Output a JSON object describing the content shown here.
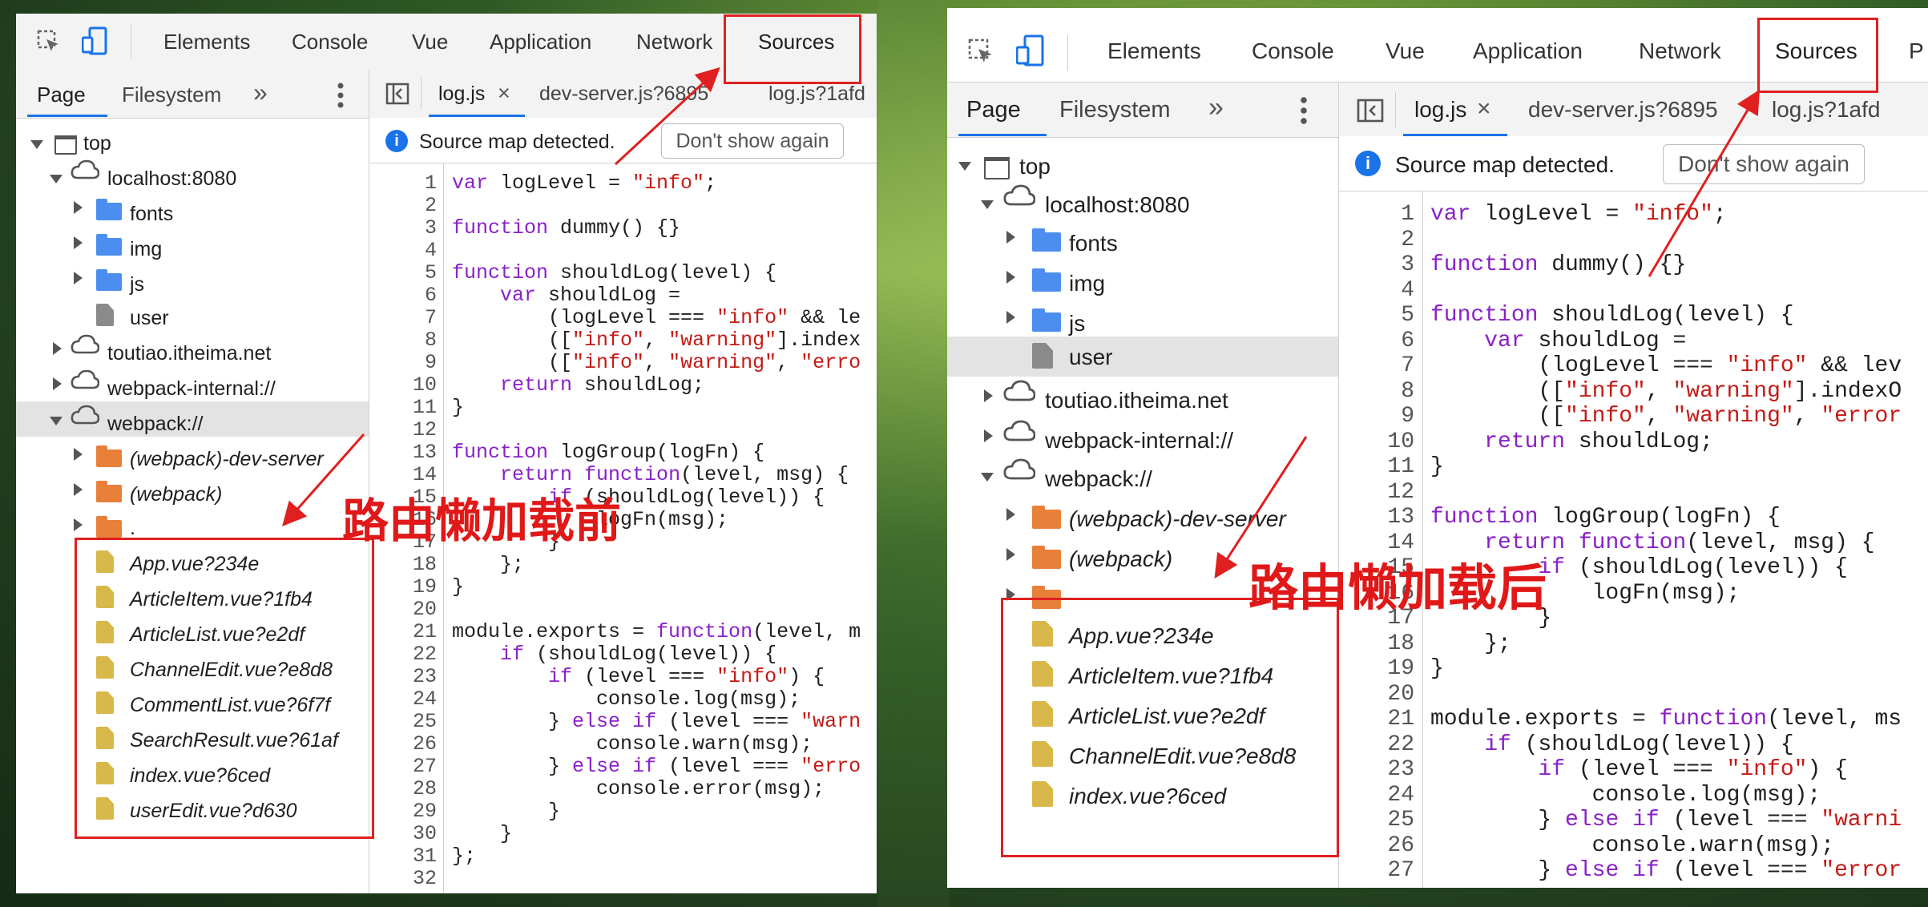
{
  "toolbar": {
    "tabs": [
      "Elements",
      "Console",
      "Vue",
      "Application",
      "Network",
      "Sources"
    ],
    "extra_tab_truncated": "P"
  },
  "navigator": {
    "tabs": [
      "Page",
      "Filesystem"
    ],
    "more": "»"
  },
  "editor": {
    "tabs": [
      "log.js",
      "dev-server.js?6895",
      "log.js?1afd"
    ],
    "close_glyph": "×"
  },
  "infobar": {
    "message": "Source map detected.",
    "button": "Don't show again"
  },
  "left_panel": {
    "tree": {
      "top": "top",
      "localhost": "localhost:8080",
      "fonts": "fonts",
      "img": "img",
      "js": "js",
      "user": "user",
      "toutiao": "toutiao.itheima.net",
      "webpack_internal": "webpack-internal://",
      "webpack": "webpack://",
      "dev_server": "(webpack)-dev-server",
      "webpack_folder": "(webpack)",
      "dot": ".",
      "files": [
        "App.vue?234e",
        "ArticleItem.vue?1fb4",
        "ArticleList.vue?e2df",
        "ChannelEdit.vue?e8d8",
        "CommentList.vue?6f7f",
        "SearchResult.vue?61af",
        "index.vue?6ced",
        "userEdit.vue?d630"
      ]
    },
    "caption": "路由懒加载前",
    "code_lines": [
      "var logLevel = \"info\";",
      "",
      "function dummy() {}",
      "",
      "function shouldLog(level) {",
      "    var shouldLog =",
      "        (logLevel === \"info\" && le",
      "        ([\"info\", \"warning\"].index",
      "        ([\"info\", \"warning\", \"erro",
      "    return shouldLog;",
      "}",
      "",
      "function logGroup(logFn) {",
      "    return function(level, msg) {",
      "        if (shouldLog(level)) {",
      "            logFn(msg);",
      "        }",
      "    };",
      "}",
      "",
      "module.exports = function(level, m",
      "    if (shouldLog(level)) {",
      "        if (level === \"info\") {",
      "            console.log(msg);",
      "        } else if (level === \"warn",
      "            console.warn(msg);",
      "        } else if (level === \"erro",
      "            console.error(msg);",
      "        }",
      "    }",
      "};",
      ""
    ]
  },
  "right_panel": {
    "tree": {
      "top": "top",
      "localhost": "localhost:8080",
      "fonts": "fonts",
      "img": "img",
      "js": "js",
      "user": "user",
      "toutiao": "toutiao.itheima.net",
      "webpack_internal": "webpack-internal://",
      "webpack": "webpack://",
      "dev_server": "(webpack)-dev-server",
      "webpack_folder": "(webpack)",
      "files": [
        "App.vue?234e",
        "ArticleItem.vue?1fb4",
        "ArticleList.vue?e2df",
        "ChannelEdit.vue?e8d8",
        "index.vue?6ced"
      ]
    },
    "caption": "路由懒加载后",
    "code_lines": [
      "var logLevel = \"info\";",
      "",
      "function dummy() {}",
      "",
      "function shouldLog(level) {",
      "    var shouldLog =",
      "        (logLevel === \"info\" && lev",
      "        ([\"info\", \"warning\"].indexO",
      "        ([\"info\", \"warning\", \"error",
      "    return shouldLog;",
      "}",
      "",
      "function logGroup(logFn) {",
      "    return function(level, msg) {",
      "        if (shouldLog(level)) {",
      "            logFn(msg);",
      "        }",
      "    };",
      "}",
      "",
      "module.exports = function(level, ms",
      "    if (shouldLog(level)) {",
      "        if (level === \"info\") {",
      "            console.log(msg);",
      "        } else if (level === \"warni",
      "            console.warn(msg);",
      "        } else if (level === \"error"
    ]
  },
  "colors": {
    "annotation_red": "#e02020",
    "accent_blue": "#1a73e8",
    "folder_blue": "#4b8ef0",
    "folder_orange": "#e8803a",
    "file_yellow": "#d8b84a"
  }
}
